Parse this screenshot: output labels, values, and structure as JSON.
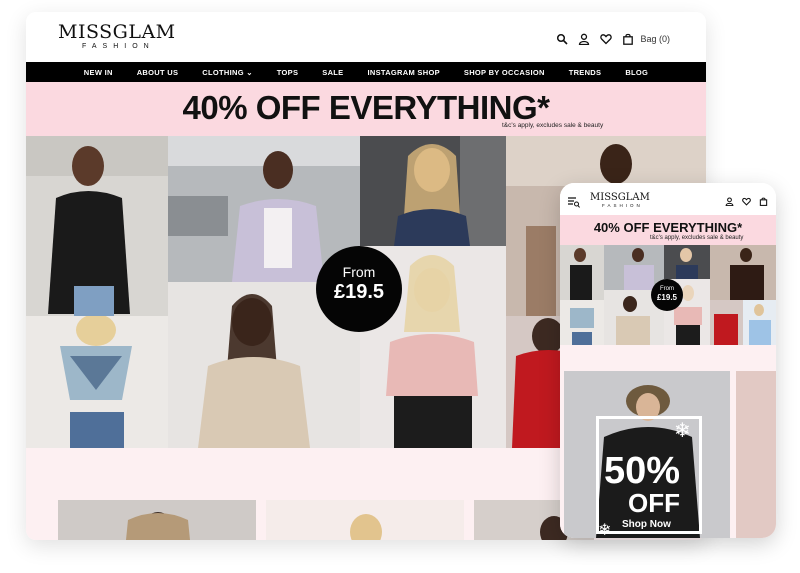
{
  "brand": {
    "name": "MISSGLAM",
    "sub": "FASHION"
  },
  "header": {
    "icons": [
      "search-icon",
      "user-icon",
      "heart-icon",
      "bag-icon"
    ],
    "bag_label": "Bag (0)"
  },
  "nav": {
    "items": [
      {
        "label": "NEW IN"
      },
      {
        "label": "ABOUT US"
      },
      {
        "label": "CLOTHING ⌄"
      },
      {
        "label": "TOPS"
      },
      {
        "label": "SALE"
      },
      {
        "label": "INSTAGRAM SHOP"
      },
      {
        "label": "SHOP BY OCCASION"
      },
      {
        "label": "TRENDS"
      },
      {
        "label": "BLOG"
      }
    ]
  },
  "banner": {
    "headline": "40% OFF EVERYTHING*",
    "note": "t&c's apply, excludes sale & beauty"
  },
  "price_badge": {
    "from": "From",
    "value": "£19.5"
  },
  "mobile": {
    "banner": {
      "headline": "40% OFF EVERYTHING*",
      "note": "t&c's apply, excludes sale & beauty"
    },
    "price_badge": {
      "from": "From",
      "value": "£19.5"
    },
    "promo": {
      "percent": "50%",
      "off": "OFF",
      "cta": "Shop Now"
    }
  },
  "colors": {
    "banner_pink": "#fbd9e0",
    "nav_black": "#000000",
    "page_bg_pink": "#fdf0f2"
  }
}
